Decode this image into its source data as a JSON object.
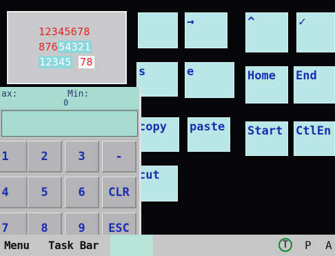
{
  "preview": {
    "line1": "12345678",
    "line2_red": "876",
    "line2_hl": "54321",
    "line3_cyan": "12345",
    "line3_red": "78"
  },
  "keys_top": {
    "arrow_right": "→",
    "caret": "^",
    "check": "✓"
  },
  "keys_mid": {
    "s": "s",
    "e": "e",
    "home": "Home",
    "end": "End",
    "copy": "copy",
    "paste": "paste",
    "start": "Start",
    "ctlend": "CtlEn",
    "cut": "cut"
  },
  "keypad": {
    "max_label": "ax:",
    "min_label": "Min:",
    "min_value": "0",
    "keys": [
      "1",
      "2",
      "3",
      "-",
      "4",
      "5",
      "6",
      "CLR",
      "7",
      "8",
      "9",
      "ESC"
    ]
  },
  "taskbar": {
    "menu": "Menu",
    "task_bar": "Task Bar",
    "t": "T",
    "p": "P",
    "a": "A"
  },
  "colors": {
    "tile": "#b9e6e6",
    "key_text": "#1a2db0",
    "preview_red": "#e22222",
    "taskbar": "#c6c6c6"
  }
}
